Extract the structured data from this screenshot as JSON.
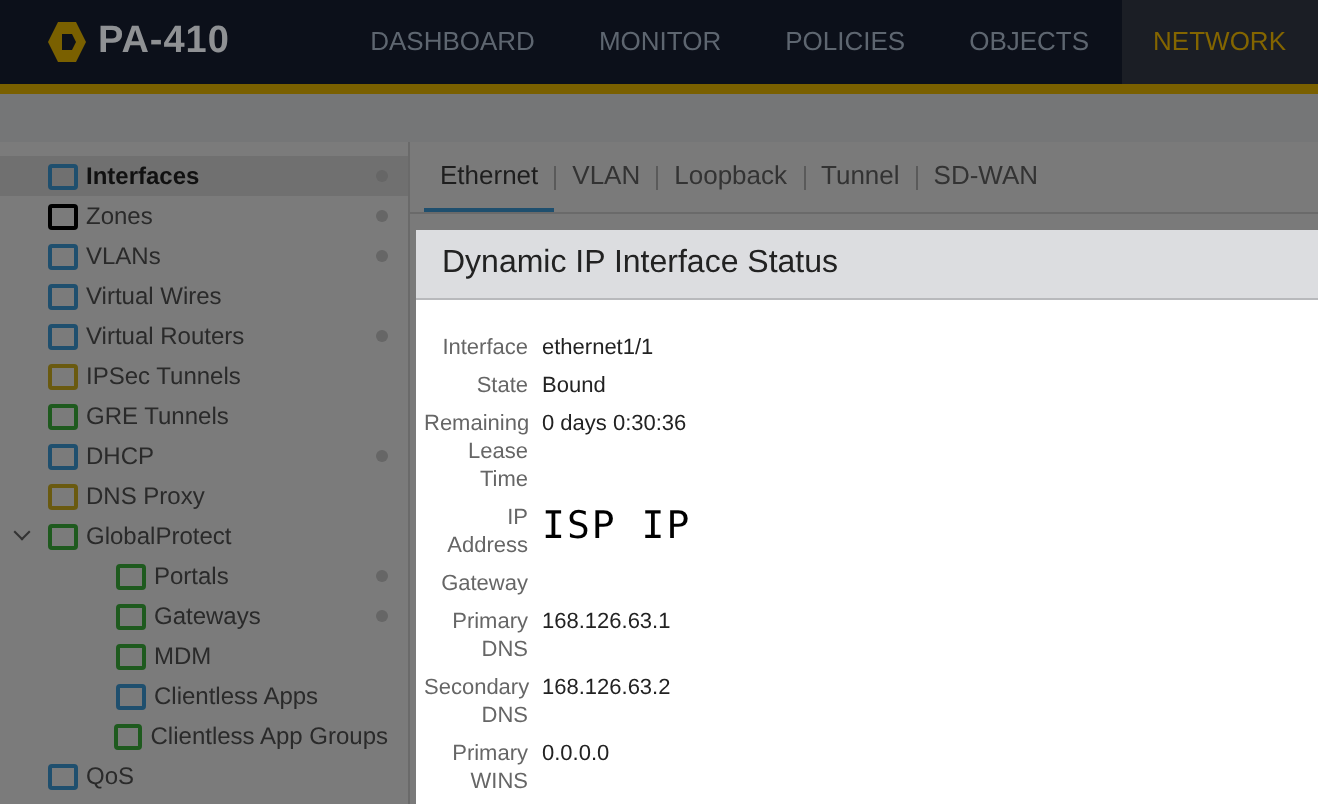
{
  "header": {
    "product": "PA-410",
    "nav": [
      {
        "label": "DASHBOARD",
        "selected": false
      },
      {
        "label": "MONITOR",
        "selected": false
      },
      {
        "label": "POLICIES",
        "selected": false
      },
      {
        "label": "OBJECTS",
        "selected": false
      },
      {
        "label": "NETWORK",
        "selected": true
      }
    ]
  },
  "sidebar": {
    "items": [
      {
        "label": "Interfaces",
        "selected": true,
        "dot": true
      },
      {
        "label": "Zones",
        "selected": false,
        "dot": true
      },
      {
        "label": "VLANs",
        "selected": false,
        "dot": true
      },
      {
        "label": "Virtual Wires",
        "selected": false,
        "dot": false
      },
      {
        "label": "Virtual Routers",
        "selected": false,
        "dot": true
      },
      {
        "label": "IPSec Tunnels",
        "selected": false,
        "dot": false
      },
      {
        "label": "GRE Tunnels",
        "selected": false,
        "dot": false
      },
      {
        "label": "DHCP",
        "selected": false,
        "dot": true
      },
      {
        "label": "DNS Proxy",
        "selected": false,
        "dot": false
      },
      {
        "label": "GlobalProtect",
        "selected": false,
        "dot": false,
        "expanded": true,
        "children": [
          {
            "label": "Portals",
            "selected": false,
            "dot": true
          },
          {
            "label": "Gateways",
            "selected": false,
            "dot": true
          },
          {
            "label": "MDM",
            "selected": false,
            "dot": false
          },
          {
            "label": "Clientless Apps",
            "selected": false,
            "dot": false
          },
          {
            "label": "Clientless App Groups",
            "selected": false,
            "dot": false
          }
        ]
      },
      {
        "label": "QoS",
        "selected": false,
        "dot": false
      }
    ]
  },
  "tabs": [
    {
      "label": "Ethernet",
      "selected": true
    },
    {
      "label": "VLAN",
      "selected": false
    },
    {
      "label": "Loopback",
      "selected": false
    },
    {
      "label": "Tunnel",
      "selected": false
    },
    {
      "label": "SD-WAN",
      "selected": false
    }
  ],
  "dialog": {
    "title": "Dynamic IP Interface Status",
    "rows": [
      {
        "label": "Interface",
        "value": "ethernet1/1"
      },
      {
        "label": "State",
        "value": "Bound"
      },
      {
        "label": "Remaining Lease Time",
        "value": "0 days 0:30:36"
      },
      {
        "label": "IP Address",
        "value": "ISP IP",
        "kind": "handwritten"
      },
      {
        "label": "Gateway"
      },
      {
        "label": "Primary DNS",
        "value": "168.126.63.1"
      },
      {
        "label": "Secondary DNS",
        "value": "168.126.63.2"
      },
      {
        "label": "Primary WINS",
        "value": "0.0.0.0"
      }
    ]
  }
}
